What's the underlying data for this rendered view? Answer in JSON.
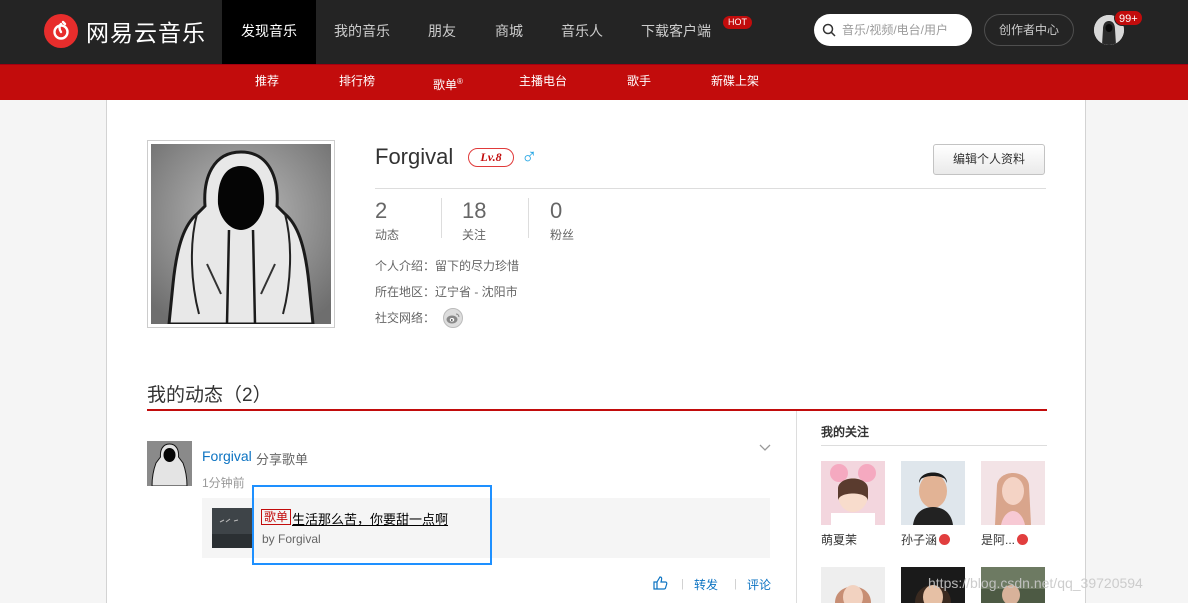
{
  "brand": {
    "name": "网易云音乐"
  },
  "top_nav": {
    "items": [
      {
        "label": "发现音乐"
      },
      {
        "label": "我的音乐"
      },
      {
        "label": "朋友"
      },
      {
        "label": "商城"
      },
      {
        "label": "音乐人"
      },
      {
        "label": "下载客户端"
      }
    ],
    "hot_badge": "HOT",
    "search_placeholder": "音乐/视频/电台/用户",
    "creator_label": "创作者中心",
    "message_count": "99+"
  },
  "sub_nav": {
    "items": [
      {
        "label": "推荐"
      },
      {
        "label": "排行榜"
      },
      {
        "label": "歌单",
        "sup": "®"
      },
      {
        "label": "主播电台"
      },
      {
        "label": "歌手"
      },
      {
        "label": "新碟上架"
      }
    ]
  },
  "profile": {
    "username": "Forgival",
    "level": "Lv.8",
    "gender_symbol": "♂",
    "edit_label": "编辑个人资料",
    "stats": [
      {
        "value": "2",
        "label": "动态"
      },
      {
        "value": "18",
        "label": "关注"
      },
      {
        "value": "0",
        "label": "粉丝"
      }
    ],
    "intro_label": "个人介绍：",
    "intro_value": "留下的尽力珍惜",
    "region_label": "所在地区：",
    "region_value": "辽宁省 - 沈阳市",
    "social_label": "社交网络："
  },
  "feed_section": {
    "title": "我的动态（2）",
    "item": {
      "user": "Forgival",
      "action": "分享歌单",
      "time": "1分钟前",
      "card_tag": "歌单",
      "card_title": "生活那么苦，你要甜一点啊",
      "card_by": "by Forgival",
      "actions": {
        "forward": "转发",
        "comment": "评论"
      }
    }
  },
  "follows": {
    "title": "我的关注",
    "users": [
      {
        "name": "萌夏茉"
      },
      {
        "name": "孙子涵"
      },
      {
        "name": "是阿..."
      }
    ]
  },
  "watermark": "https://blog.csdn.net/qq_39720594",
  "colors": {
    "brand_red": "#c20c0c",
    "link_blue": "#0c73c2",
    "nav_dark": "#242424"
  }
}
